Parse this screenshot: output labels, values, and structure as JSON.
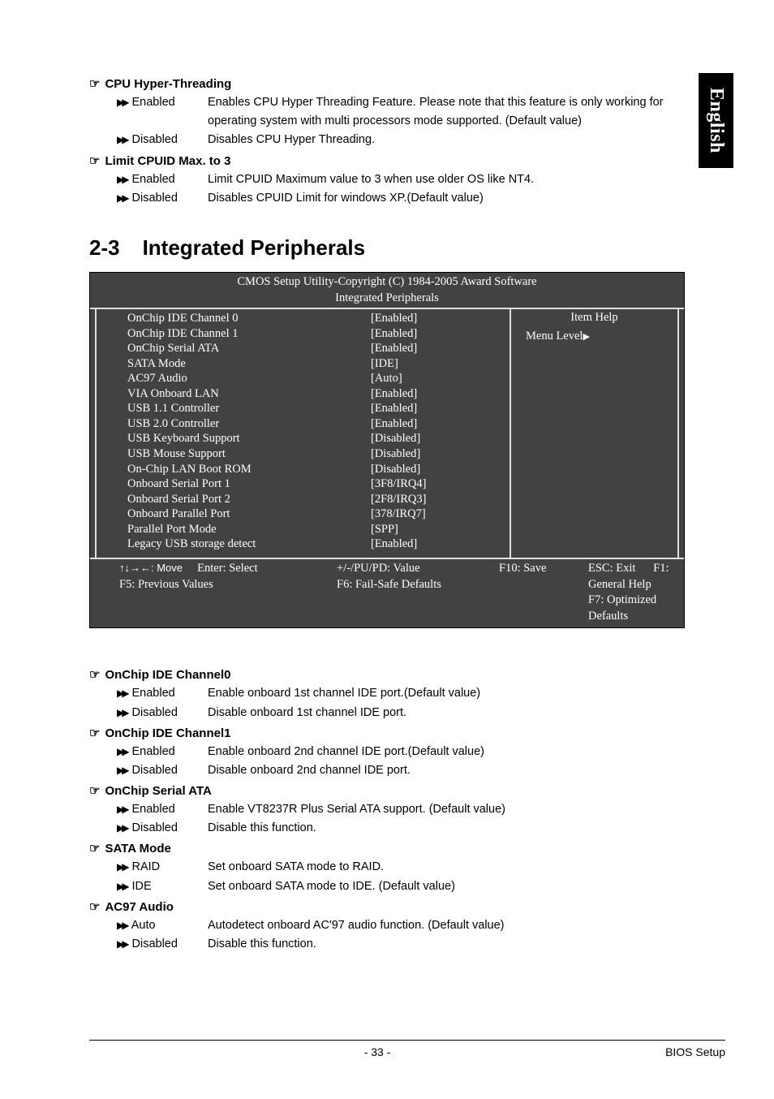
{
  "langTab": "English",
  "top": {
    "cpuHT": {
      "title": "CPU Hyper-Threading",
      "enabled": {
        "label": "Enabled",
        "desc": "Enables CPU Hyper Threading Feature. Please note that this feature is only working for operating system with multi processors mode supported. (Default value)"
      },
      "disabled": {
        "label": "Disabled",
        "desc": "Disables CPU Hyper Threading."
      }
    },
    "limit": {
      "title": "Limit CPUID Max. to 3",
      "enabled": {
        "label": "Enabled",
        "desc": "Limit CPUID Maximum value to 3 when use older OS like NT4."
      },
      "disabled": {
        "label": "Disabled",
        "desc": "Disables CPUID Limit for windows XP.(Default value)"
      }
    }
  },
  "h2": {
    "num": "2-3",
    "title": "Integrated Peripherals"
  },
  "bios": {
    "header1": "CMOS Setup Utility-Copyright (C) 1984-2005 Award Software",
    "header2": "Integrated Peripherals",
    "rows": [
      {
        "k": "OnChip IDE Channel 0",
        "v": "[Enabled]"
      },
      {
        "k": "OnChip IDE Channel 1",
        "v": "[Enabled]"
      },
      {
        "k": "OnChip Serial ATA",
        "v": "[Enabled]"
      },
      {
        "k": "SATA Mode",
        "v": "[IDE]"
      },
      {
        "k": "AC97 Audio",
        "v": "[Auto]"
      },
      {
        "k": "VIA Onboard LAN",
        "v": "[Enabled]"
      },
      {
        "k": "USB 1.1 Controller",
        "v": "[Enabled]"
      },
      {
        "k": "USB 2.0 Controller",
        "v": "[Enabled]"
      },
      {
        "k": "USB Keyboard Support",
        "v": "[Disabled]"
      },
      {
        "k": "USB Mouse Support",
        "v": "[Disabled]"
      },
      {
        "k": "On-Chip LAN Boot ROM",
        "v": "[Disabled]"
      },
      {
        "k": "Onboard Serial Port 1",
        "v": "[3F8/IRQ4]"
      },
      {
        "k": "Onboard Serial Port 2",
        "v": "[2F8/IRQ3]"
      },
      {
        "k": "Onboard Parallel Port",
        "v": "[378/IRQ7]"
      },
      {
        "k": "Parallel Port Mode",
        "v": "[SPP]"
      },
      {
        "k": "Legacy USB storage detect",
        "v": "[Enabled]"
      }
    ],
    "help": {
      "itemHelp": "Item Help",
      "menuLevel": "Menu Level"
    },
    "footer": {
      "move": "↑↓→←: Move",
      "enter": "Enter: Select",
      "prev": "F5: Previous Values",
      "value": "+/-/PU/PD: Value",
      "failsafe": "F6: Fail-Safe Defaults",
      "save": "F10: Save",
      "esc": "ESC: Exit",
      "genhelp": "F1: General Help",
      "opt": "F7: Optimized Defaults"
    }
  },
  "bottom": {
    "ide0": {
      "title": "OnChip IDE Channel0",
      "enabled": {
        "label": "Enabled",
        "desc": "Enable onboard 1st channel IDE port.(Default value)"
      },
      "disabled": {
        "label": "Disabled",
        "desc": "Disable onboard 1st channel IDE port."
      }
    },
    "ide1": {
      "title": "OnChip IDE Channel1",
      "enabled": {
        "label": "Enabled",
        "desc": "Enable onboard 2nd channel IDE port.(Default value)"
      },
      "disabled": {
        "label": "Disabled",
        "desc": "Disable onboard 2nd channel IDE port."
      }
    },
    "sata": {
      "title": "OnChip Serial ATA",
      "enabled": {
        "label": "Enabled",
        "desc": "Enable VT8237R Plus Serial ATA support. (Default value)"
      },
      "disabled": {
        "label": "Disabled",
        "desc": "Disable this function."
      }
    },
    "sataMode": {
      "title": "SATA Mode",
      "raid": {
        "label": "RAID",
        "desc": "Set onboard SATA mode to RAID."
      },
      "ide": {
        "label": "IDE",
        "desc": "Set onboard SATA mode to IDE. (Default value)"
      }
    },
    "ac97": {
      "title": "AC97 Audio",
      "auto": {
        "label": "Auto",
        "desc": "Autodetect onboard AC'97 audio function. (Default value)"
      },
      "disabled": {
        "label": "Disabled",
        "desc": "Disable this function."
      }
    }
  },
  "footer": {
    "page": "- 33 -",
    "section": "BIOS Setup"
  }
}
